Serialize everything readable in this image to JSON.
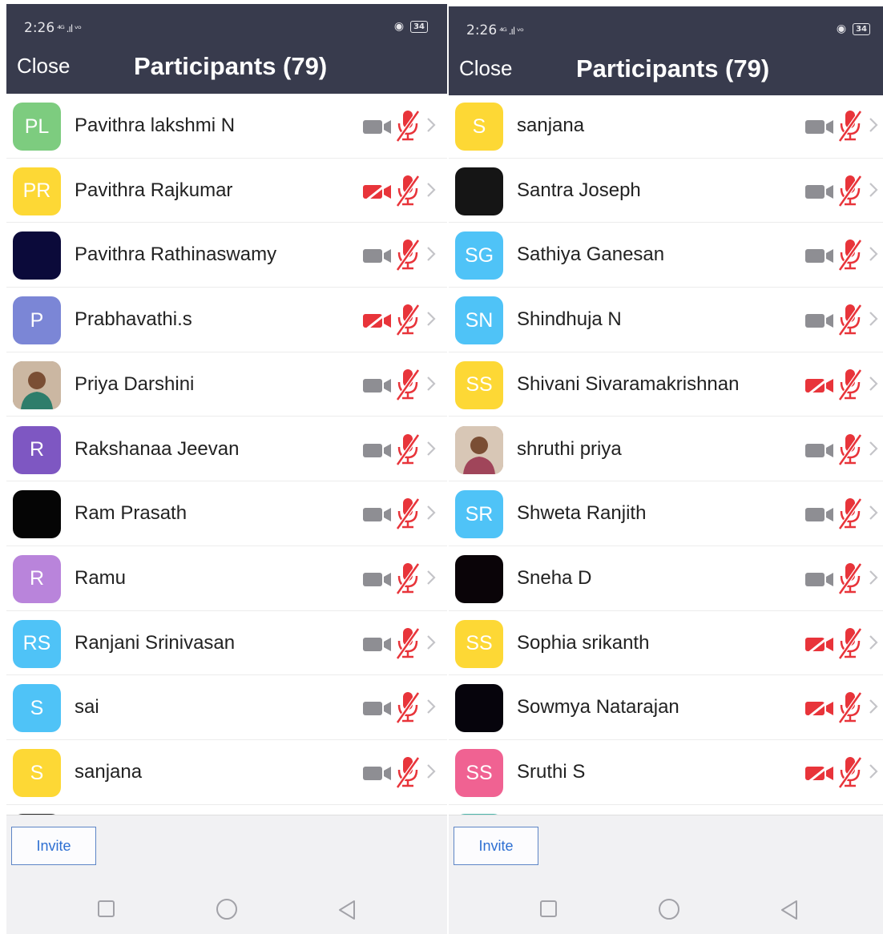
{
  "status_bar": {
    "time": "2:26",
    "signal": "⁴ᴳ .ıl ᵛᵒ",
    "battery": "34"
  },
  "header": {
    "close_label": "Close",
    "title": "Participants (79)"
  },
  "footer": {
    "invite_label": "Invite"
  },
  "colors": {
    "header_bg": "#383b4d",
    "muted_red": "#e8343a",
    "icon_gray": "#8e8e93",
    "link_blue": "#2d6fd2"
  },
  "screens": [
    {
      "participants": [
        {
          "initials": "PL",
          "name": "Pavithra lakshmi N",
          "avatar_color": "#7dcc7f",
          "video_off": false
        },
        {
          "initials": "PR",
          "name": "Pavithra Rajkumar",
          "avatar_color": "#fdd835",
          "video_off": true
        },
        {
          "initials": "",
          "name": "Pavithra Rathinaswamy",
          "avatar_color": "#0b0a3a",
          "video_off": false
        },
        {
          "initials": "P",
          "name": "Prabhavathi.s",
          "avatar_color": "#7b86d6",
          "video_off": true
        },
        {
          "initials": "",
          "name": "Priya Darshini",
          "avatar_color": "#9a8068",
          "photo": true,
          "video_off": false
        },
        {
          "initials": "R",
          "name": "Rakshanaa Jeevan",
          "avatar_color": "#7e57c2",
          "video_off": false
        },
        {
          "initials": "",
          "name": "Ram Prasath",
          "avatar_color": "#050505",
          "video_off": false
        },
        {
          "initials": "R",
          "name": "Ramu",
          "avatar_color": "#b984db",
          "video_off": false
        },
        {
          "initials": "RS",
          "name": "Ranjani Srinivasan",
          "avatar_color": "#4fc3f7",
          "video_off": false
        },
        {
          "initials": "S",
          "name": "sai",
          "avatar_color": "#4fc3f7",
          "video_off": false
        },
        {
          "initials": "S",
          "name": "sanjana",
          "avatar_color": "#fdd835",
          "video_off": false
        }
      ],
      "partial_row": {
        "avatar_color": "#2a2a2a"
      }
    },
    {
      "participants": [
        {
          "initials": "S",
          "name": "sanjana",
          "avatar_color": "#fdd835",
          "video_off": false
        },
        {
          "initials": "",
          "name": "Santra Joseph",
          "avatar_color": "#151515",
          "video_off": false
        },
        {
          "initials": "SG",
          "name": "Sathiya Ganesan",
          "avatar_color": "#4fc3f7",
          "video_off": false
        },
        {
          "initials": "SN",
          "name": "Shindhuja N",
          "avatar_color": "#4fc3f7",
          "video_off": false
        },
        {
          "initials": "SS",
          "name": "Shivani Sivaramakrishnan",
          "avatar_color": "#fdd835",
          "video_off": true
        },
        {
          "initials": "",
          "name": "shruthi priya",
          "avatar_color": "#b99178",
          "photo": true,
          "video_off": false
        },
        {
          "initials": "SR",
          "name": "Shweta Ranjith",
          "avatar_color": "#4fc3f7",
          "video_off": false
        },
        {
          "initials": "",
          "name": "Sneha D",
          "avatar_color": "#0a0408",
          "video_off": false
        },
        {
          "initials": "SS",
          "name": "Sophia srikanth",
          "avatar_color": "#fdd835",
          "video_off": true
        },
        {
          "initials": "",
          "name": "Sowmya Natarajan",
          "avatar_color": "#06040c",
          "video_off": true
        },
        {
          "initials": "SS",
          "name": "Sruthi S",
          "avatar_color": "#f06292",
          "video_off": true
        }
      ],
      "partial_row": {
        "avatar_color": "#4db6ac"
      }
    }
  ]
}
